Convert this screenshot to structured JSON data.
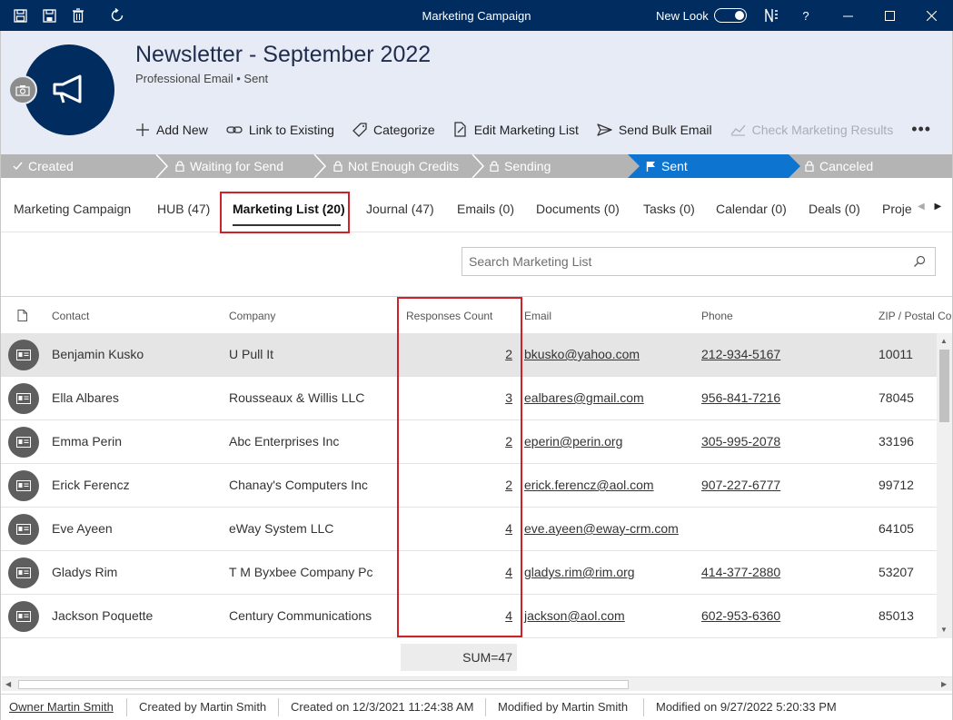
{
  "window": {
    "title": "Marketing Campaign",
    "new_look_label": "New Look",
    "help_label": "?",
    "colors": {
      "titlebar": "#002c5f",
      "header_bg": "#e7ebf6",
      "active_stage": "#0d74d0",
      "highlight": "#d0202a"
    }
  },
  "header": {
    "title": "Newsletter - September 2022",
    "subtitle": "Professional Email • Sent",
    "actions": [
      {
        "label": "Add New",
        "icon": "plus-icon",
        "enabled": true
      },
      {
        "label": "Link to Existing",
        "icon": "link-icon",
        "enabled": true
      },
      {
        "label": "Categorize",
        "icon": "tag-icon",
        "enabled": true
      },
      {
        "label": "Edit Marketing List",
        "icon": "edit-document-icon",
        "enabled": true
      },
      {
        "label": "Send Bulk Email",
        "icon": "send-icon",
        "enabled": true
      },
      {
        "label": "Check Marketing Results",
        "icon": "chart-icon",
        "enabled": false
      }
    ]
  },
  "stages": [
    {
      "label": "Created",
      "icon": "check-icon"
    },
    {
      "label": "Waiting for Send",
      "icon": "lock-icon"
    },
    {
      "label": "Not Enough Credits",
      "icon": "lock-icon"
    },
    {
      "label": "Sending",
      "icon": "lock-icon"
    },
    {
      "label": "Sent",
      "icon": "flag-icon",
      "active": true
    },
    {
      "label": "Canceled",
      "icon": "lock-icon"
    }
  ],
  "tabs": [
    {
      "label": "Marketing Campaign"
    },
    {
      "label": "HUB (47)"
    },
    {
      "label": "Marketing List (20)",
      "active": true
    },
    {
      "label": "Journal (47)"
    },
    {
      "label": "Emails (0)"
    },
    {
      "label": "Documents (0)"
    },
    {
      "label": "Tasks (0)"
    },
    {
      "label": "Calendar (0)"
    },
    {
      "label": "Deals (0)"
    },
    {
      "label": "Proje"
    }
  ],
  "search": {
    "placeholder": "Search Marketing List"
  },
  "grid": {
    "columns": [
      "Contact",
      "Company",
      "Responses Count",
      "Email",
      "Phone",
      "ZIP / Postal Co"
    ],
    "rows": [
      {
        "contact": "Benjamin Kusko",
        "company": "U Pull It",
        "responses": "2",
        "email": "bkusko@yahoo.com",
        "phone": "212-934-5167",
        "zip": "10011",
        "selected": true
      },
      {
        "contact": "Ella Albares",
        "company": "Rousseaux & Willis LLC",
        "responses": "3",
        "email": "ealbares@gmail.com",
        "phone": "956-841-7216",
        "zip": "78045"
      },
      {
        "contact": "Emma Perin",
        "company": "Abc Enterprises Inc",
        "responses": "2",
        "email": "eperin@perin.org",
        "phone": "305-995-2078",
        "zip": "33196"
      },
      {
        "contact": "Erick Ferencz",
        "company": "Chanay's Computers Inc",
        "responses": "2",
        "email": "erick.ferencz@aol.com",
        "phone": "907-227-6777",
        "zip": "99712"
      },
      {
        "contact": "Eve Ayeen",
        "company": "eWay System LLC",
        "responses": "4",
        "email": "eve.ayeen@eway-crm.com",
        "phone": "",
        "zip": "64105"
      },
      {
        "contact": "Gladys Rim",
        "company": "T M Byxbee Company Pc",
        "responses": "4",
        "email": "gladys.rim@rim.org",
        "phone": "414-377-2880",
        "zip": "53207"
      },
      {
        "contact": "Jackson Poquette",
        "company": "Century Communications",
        "responses": "4",
        "email": "jackson@aol.com",
        "phone": "602-953-6360",
        "zip": "85013"
      }
    ],
    "sum_label": "SUM=47"
  },
  "status": {
    "owner": "Owner Martin Smith",
    "created_by": "Created by Martin Smith",
    "created_on": "Created on 12/3/2021 11:24:38 AM",
    "modified_by": "Modified by Martin Smith",
    "modified_on": "Modified on 9/27/2022 5:20:33 PM"
  }
}
